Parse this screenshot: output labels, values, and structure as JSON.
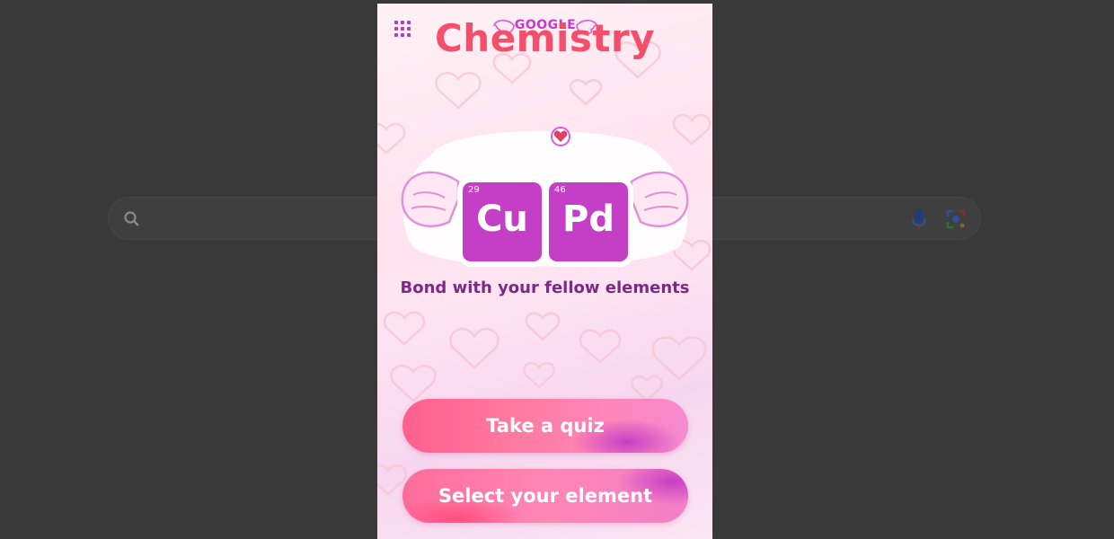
{
  "header": {
    "logo_text": "GOOGLE"
  },
  "hero": {
    "title": "Chemistry",
    "elements": [
      {
        "number": "29",
        "symbol": "Cu"
      },
      {
        "number": "46",
        "symbol": "Pd"
      }
    ],
    "tagline": "Bond with your fellow elements"
  },
  "actions": {
    "quiz_label": "Take a quiz",
    "select_label": "Select your element"
  },
  "colors": {
    "accent": "#c43fc6",
    "title": "#f34f6a",
    "tagline": "#7a2a86",
    "button_pink": "#ff7aa0"
  },
  "icons": {
    "apps": "apps-grid-icon",
    "search": "search-icon",
    "mic": "mic-icon",
    "lens": "camera-lens-icon",
    "wings": "wings-icon",
    "heart": "heart-icon"
  }
}
